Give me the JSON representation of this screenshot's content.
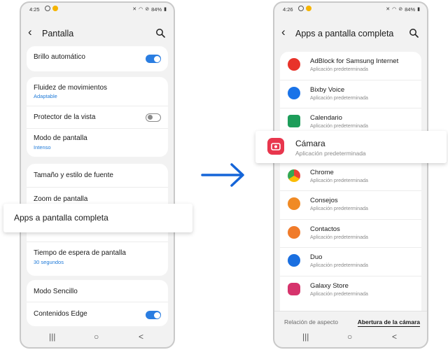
{
  "left_phone": {
    "status": {
      "time": "4:25",
      "battery": "84%"
    },
    "title": "Pantalla",
    "items": [
      {
        "label": "Brillo automático",
        "toggle": "on"
      },
      {
        "label": "Fluidez de movimientos",
        "sub": "Adaptable"
      },
      {
        "label": "Protector de la vista",
        "toggle": "off"
      },
      {
        "label": "Modo de pantalla",
        "sub": "Intenso"
      },
      {
        "label": "Tamaño y estilo de fuente"
      },
      {
        "label": "Zoom de pantalla"
      },
      {
        "label": "Apps a pantalla completa"
      },
      {
        "label": "Tiempo de espera de pantalla",
        "sub": "30 segundos"
      },
      {
        "label": "Modo Sencillo"
      },
      {
        "label": "Contenidos Edge",
        "toggle": "on"
      }
    ],
    "navbar": {
      "recents": "|||",
      "home": "○",
      "back": "<"
    }
  },
  "right_phone": {
    "status": {
      "time": "4:26",
      "battery": "84%"
    },
    "title": "Apps a pantalla completa",
    "apps": [
      {
        "name": "AdBlock for Samsung Internet",
        "sub": "Aplicación predeterminada",
        "icon": "adblock-icon",
        "color": "#e8332a"
      },
      {
        "name": "Bixby Voice",
        "sub": "Aplicación predeterminada",
        "icon": "bixby-icon",
        "color": "#1a73e8"
      },
      {
        "name": "Calendario",
        "sub": "Aplicación predeterminada",
        "icon": "calendar-icon",
        "color": "#1d9d5a"
      },
      {
        "name": "Cámara",
        "sub": "Aplicación predeterminada",
        "icon": "camera-icon",
        "color": "#e8364d"
      },
      {
        "name": "Chrome",
        "sub": "Aplicación predeterminada",
        "icon": "chrome-icon",
        "color": "#4285f4"
      },
      {
        "name": "Consejos",
        "sub": "Aplicación predeterminada",
        "icon": "tips-icon",
        "color": "#f08a24"
      },
      {
        "name": "Contactos",
        "sub": "Aplicación predeterminada",
        "icon": "contacts-icon",
        "color": "#f07b2a"
      },
      {
        "name": "Duo",
        "sub": "Aplicación predeterminada",
        "icon": "duo-icon",
        "color": "#1a6fe0"
      },
      {
        "name": "Galaxy Store",
        "sub": "Aplicación predeterminada",
        "icon": "galaxy-store-icon",
        "color": "#d6336c"
      }
    ],
    "tabs": {
      "aspect": "Relación de aspecto",
      "cutout": "Abertura de la cámara"
    },
    "navbar": {
      "recents": "|||",
      "home": "○",
      "back": "<"
    }
  },
  "colors": {
    "accent": "#2a7de1",
    "arrow": "#1565d8",
    "sub_text": "#1f7ad8"
  }
}
